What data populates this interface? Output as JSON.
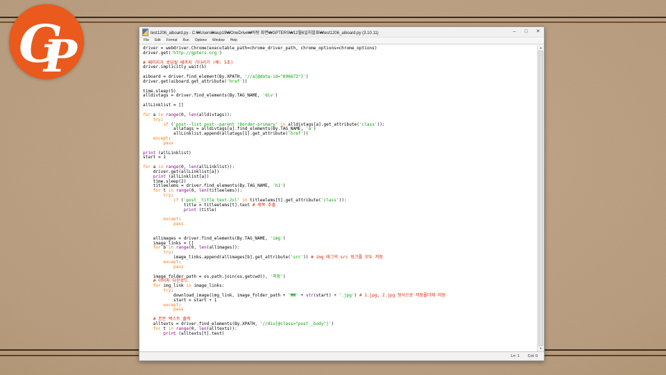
{
  "background": {
    "paper_color": "#b69979",
    "line_color": "#3a2b18"
  },
  "logo": {
    "letter_g": "G",
    "letter_p": "P",
    "color": "#e95a1c"
  },
  "window": {
    "title": "test1206_aiboard.py - C:₩Users₩aup19₩OneDrive₩바탕 화면₩GPTERS₩12월6일자발표₩test1206_aiboard.py (3.10.11)",
    "controls": {
      "minimize": "–",
      "maximize": "□",
      "close": "✕"
    },
    "menu": [
      "File",
      "Edit",
      "Format",
      "Run",
      "Options",
      "Window",
      "Help"
    ],
    "status": {
      "ln_label": "Ln: 1",
      "col_label": "Col: 0"
    }
  },
  "editor": {
    "colors": {
      "p": "#000000",
      "k": "#ff7700",
      "s": "#00a000",
      "c": "#dd2200",
      "b": "#900090"
    },
    "lines": [
      [
        {
          "t": "driver = webdriver.Chrome(executable_path=chrome_driver_path, chrome_options=chrome_options)",
          "c": "p"
        }
      ],
      [
        {
          "t": "driver.get(",
          "c": "p"
        },
        {
          "t": "'http://gpters.org'",
          "c": "s"
        },
        {
          "t": ")",
          "c": "p"
        }
      ],
      [],
      [
        {
          "t": "# 페이지가 로딩될 때까지 기다리기 (예: 5초)",
          "c": "c"
        }
      ],
      [
        {
          "t": "driver.implicitly_wait(5)",
          "c": "p"
        }
      ],
      [],
      [
        {
          "t": "aiboard = driver.find_element(By.XPATH, ",
          "c": "p"
        },
        {
          "t": "'//a[@data-id=\"896673\"]'",
          "c": "s"
        },
        {
          "t": ")",
          "c": "p"
        }
      ],
      [
        {
          "t": "driver.get(aiboard.get_attribute(",
          "c": "p"
        },
        {
          "t": "'href'",
          "c": "s"
        },
        {
          "t": "))",
          "c": "p"
        }
      ],
      [],
      [
        {
          "t": "time.sleep(5)",
          "c": "p"
        }
      ],
      [
        {
          "t": "alldivtags = driver.find_elements(By.TAG_NAME, ",
          "c": "p"
        },
        {
          "t": "'div'",
          "c": "s"
        },
        {
          "t": ")",
          "c": "p"
        }
      ],
      [],
      [
        {
          "t": "allLinklist = []",
          "c": "p"
        }
      ],
      [],
      [
        {
          "t": "for",
          "c": "k"
        },
        {
          "t": " a ",
          "c": "p"
        },
        {
          "t": "in",
          "c": "k"
        },
        {
          "t": " ",
          "c": "p"
        },
        {
          "t": "range",
          "c": "b"
        },
        {
          "t": "(0, ",
          "c": "p"
        },
        {
          "t": "len",
          "c": "b"
        },
        {
          "t": "(alldivtags)):",
          "c": "p"
        }
      ],
      [
        {
          "t": "    ",
          "c": "p"
        },
        {
          "t": "try",
          "c": "k"
        },
        {
          "t": ":",
          "c": "p"
        }
      ],
      [
        {
          "t": "        ",
          "c": "p"
        },
        {
          "t": "if",
          "c": "k"
        },
        {
          "t": " (",
          "c": "p"
        },
        {
          "t": "'post--list post--parent !border-primary'",
          "c": "s"
        },
        {
          "t": " ",
          "c": "p"
        },
        {
          "t": "in",
          "c": "k"
        },
        {
          "t": " alldivtags[a].get_attribute(",
          "c": "p"
        },
        {
          "t": "'class'",
          "c": "s"
        },
        {
          "t": ")):",
          "c": "p"
        }
      ],
      [
        {
          "t": "            allatags = alldivtags[a].find_elements(By.TAG_NAME, ",
          "c": "p"
        },
        {
          "t": "'a'",
          "c": "s"
        },
        {
          "t": ")",
          "c": "p"
        }
      ],
      [
        {
          "t": "            allLinklist.append(allatags[1].get_attribute(",
          "c": "p"
        },
        {
          "t": "'href'",
          "c": "s"
        },
        {
          "t": "))",
          "c": "p"
        }
      ],
      [
        {
          "t": "    ",
          "c": "p"
        },
        {
          "t": "except",
          "c": "k"
        },
        {
          "t": ":",
          "c": "p"
        }
      ],
      [
        {
          "t": "        ",
          "c": "p"
        },
        {
          "t": "pass",
          "c": "k"
        }
      ],
      [],
      [
        {
          "t": "print",
          "c": "b"
        },
        {
          "t": " (allLinklist)",
          "c": "p"
        }
      ],
      [
        {
          "t": "start = 1",
          "c": "p"
        }
      ],
      [],
      [
        {
          "t": "for",
          "c": "k"
        },
        {
          "t": " a ",
          "c": "p"
        },
        {
          "t": "in",
          "c": "k"
        },
        {
          "t": " ",
          "c": "p"
        },
        {
          "t": "range",
          "c": "b"
        },
        {
          "t": "(0, ",
          "c": "p"
        },
        {
          "t": "len",
          "c": "b"
        },
        {
          "t": "(allLinklist)):",
          "c": "p"
        }
      ],
      [
        {
          "t": "    driver.get(allLinklist[a])",
          "c": "p"
        }
      ],
      [
        {
          "t": "    ",
          "c": "p"
        },
        {
          "t": "print",
          "c": "b"
        },
        {
          "t": " (allLinklist[a])",
          "c": "p"
        }
      ],
      [
        {
          "t": "    time.sleep(2)",
          "c": "p"
        }
      ],
      [
        {
          "t": "    titleelems = driver.find_elements(By.TAG_NAME, ",
          "c": "p"
        },
        {
          "t": "'h1'",
          "c": "s"
        },
        {
          "t": ")",
          "c": "p"
        }
      ],
      [
        {
          "t": "    ",
          "c": "p"
        },
        {
          "t": "for",
          "c": "k"
        },
        {
          "t": " t ",
          "c": "p"
        },
        {
          "t": "in",
          "c": "k"
        },
        {
          "t": " ",
          "c": "p"
        },
        {
          "t": "range",
          "c": "b"
        },
        {
          "t": "(0, ",
          "c": "p"
        },
        {
          "t": "len",
          "c": "b"
        },
        {
          "t": "(titleelems)):",
          "c": "p"
        }
      ],
      [
        {
          "t": "        ",
          "c": "p"
        },
        {
          "t": "try",
          "c": "k"
        },
        {
          "t": ":",
          "c": "p"
        }
      ],
      [
        {
          "t": "            ",
          "c": "p"
        },
        {
          "t": "if",
          "c": "k"
        },
        {
          "t": " (",
          "c": "p"
        },
        {
          "t": "'post__title text-2xl'",
          "c": "s"
        },
        {
          "t": " ",
          "c": "p"
        },
        {
          "t": "in",
          "c": "k"
        },
        {
          "t": " titleelems[t].get_attribute(",
          "c": "p"
        },
        {
          "t": "'class'",
          "c": "s"
        },
        {
          "t": ")):",
          "c": "p"
        }
      ],
      [
        {
          "t": "                title = titleelems[t].text ",
          "c": "p"
        },
        {
          "t": "# 제목 추출",
          "c": "c"
        }
      ],
      [
        {
          "t": "                ",
          "c": "p"
        },
        {
          "t": "print",
          "c": "b"
        },
        {
          "t": " (title)",
          "c": "p"
        }
      ],
      [],
      [
        {
          "t": "        ",
          "c": "p"
        },
        {
          "t": "except",
          "c": "k"
        },
        {
          "t": ":",
          "c": "p"
        }
      ],
      [
        {
          "t": "            ",
          "c": "p"
        },
        {
          "t": "pass",
          "c": "k"
        }
      ],
      [],
      [],
      [
        {
          "t": "    allimages = driver.find_elements(By.TAG_NAME, ",
          "c": "p"
        },
        {
          "t": "'img'",
          "c": "s"
        },
        {
          "t": ")",
          "c": "p"
        }
      ],
      [
        {
          "t": "    image_links = []",
          "c": "p"
        }
      ],
      [
        {
          "t": "    ",
          "c": "p"
        },
        {
          "t": "for",
          "c": "k"
        },
        {
          "t": " b ",
          "c": "p"
        },
        {
          "t": "in",
          "c": "k"
        },
        {
          "t": " ",
          "c": "p"
        },
        {
          "t": "range",
          "c": "b"
        },
        {
          "t": "(0, ",
          "c": "p"
        },
        {
          "t": "len",
          "c": "b"
        },
        {
          "t": "(allimages)):",
          "c": "p"
        }
      ],
      [
        {
          "t": "        ",
          "c": "p"
        },
        {
          "t": "try",
          "c": "k"
        },
        {
          "t": ":",
          "c": "p"
        }
      ],
      [
        {
          "t": "            image_links.append(allimages[b].get_attribute(",
          "c": "p"
        },
        {
          "t": "'src'",
          "c": "s"
        },
        {
          "t": ")) ",
          "c": "p"
        },
        {
          "t": "# img 태그의 src 링크를 모두 저장",
          "c": "c"
        }
      ],
      [
        {
          "t": "        ",
          "c": "p"
        },
        {
          "t": "except",
          "c": "k"
        },
        {
          "t": ":",
          "c": "p"
        }
      ],
      [
        {
          "t": "            ",
          "c": "p"
        },
        {
          "t": "pass",
          "c": "k"
        }
      ],
      [],
      [
        {
          "t": "    image_folder_path = os.path.join(os.getcwd(), ",
          "c": "p"
        },
        {
          "t": "'저장'",
          "c": "s"
        },
        {
          "t": ")",
          "c": "p"
        }
      ],
      [
        {
          "t": "    ",
          "c": "p"
        },
        {
          "t": "# 이미지 다운로드",
          "c": "c"
        }
      ],
      [
        {
          "t": "    ",
          "c": "p"
        },
        {
          "t": "for",
          "c": "k"
        },
        {
          "t": " img_link ",
          "c": "p"
        },
        {
          "t": "in",
          "c": "k"
        },
        {
          "t": " image_links:",
          "c": "p"
        }
      ],
      [
        {
          "t": "        ",
          "c": "p"
        },
        {
          "t": "try",
          "c": "k"
        },
        {
          "t": ":",
          "c": "p"
        }
      ],
      [
        {
          "t": "            download_image(img_link, image_folder_path + ",
          "c": "p"
        },
        {
          "t": "'₩₩'",
          "c": "s"
        },
        {
          "t": " + ",
          "c": "p"
        },
        {
          "t": "str",
          "c": "b"
        },
        {
          "t": "(start) + ",
          "c": "p"
        },
        {
          "t": "'.jpg'",
          "c": "s"
        },
        {
          "t": ") ",
          "c": "p"
        },
        {
          "t": "# 1.jpg, 2.jpg 형식으로 저장폴더에 저장",
          "c": "c"
        }
      ],
      [
        {
          "t": "            start = start + 1",
          "c": "p"
        }
      ],
      [
        {
          "t": "        ",
          "c": "p"
        },
        {
          "t": "except",
          "c": "k"
        },
        {
          "t": ":",
          "c": "p"
        }
      ],
      [
        {
          "t": "            ",
          "c": "p"
        },
        {
          "t": "pass",
          "c": "k"
        }
      ],
      [],
      [
        {
          "t": "    ",
          "c": "p"
        },
        {
          "t": "# 본문 텍스트 출력",
          "c": "c"
        }
      ],
      [
        {
          "t": "    alltexts = driver.find_elements(By.XPATH, ",
          "c": "p"
        },
        {
          "t": "'//div[@class=\"post__body\"]'",
          "c": "s"
        },
        {
          "t": ")",
          "c": "p"
        }
      ],
      [
        {
          "t": "    ",
          "c": "p"
        },
        {
          "t": "for",
          "c": "k"
        },
        {
          "t": " t ",
          "c": "p"
        },
        {
          "t": "in",
          "c": "k"
        },
        {
          "t": " ",
          "c": "p"
        },
        {
          "t": "range",
          "c": "b"
        },
        {
          "t": "(0, ",
          "c": "p"
        },
        {
          "t": "len",
          "c": "b"
        },
        {
          "t": "(alltexts)):",
          "c": "p"
        }
      ],
      [
        {
          "t": "        ",
          "c": "p"
        },
        {
          "t": "print",
          "c": "b"
        },
        {
          "t": " (alltexts[t].text)",
          "c": "p"
        }
      ]
    ]
  },
  "icons": {
    "scroll_up": "▲",
    "scroll_down": "▼"
  }
}
